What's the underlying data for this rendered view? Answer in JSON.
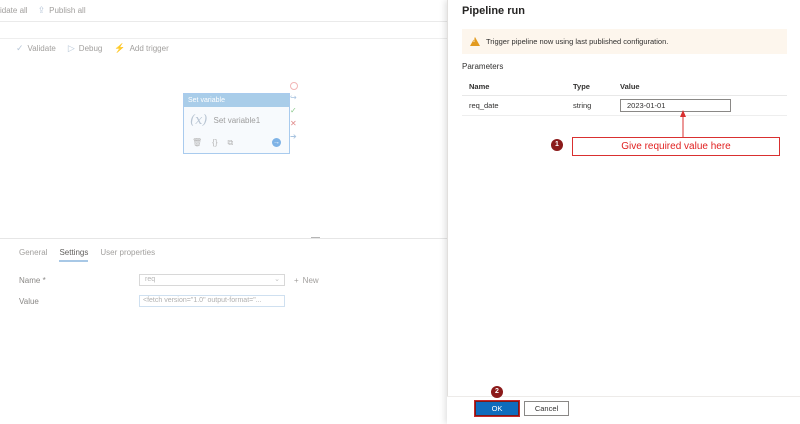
{
  "topbar": {
    "validate_all": "idate all",
    "publish_all": "Publish all"
  },
  "toolbar": {
    "validate": "Validate",
    "debug": "Debug",
    "add_trigger": "Add trigger"
  },
  "activity": {
    "header": "Set variable",
    "name": "Set variable1",
    "fx_symbol": "(𝑥)"
  },
  "bottom": {
    "tabs": [
      {
        "label": "General"
      },
      {
        "label": "Settings"
      },
      {
        "label": "User properties"
      }
    ],
    "name_label": "Name *",
    "name_value": "req",
    "new_label": "New",
    "value_label": "Value",
    "value_text": "<fetch version=\"1.0\" output-format=\"..."
  },
  "panel": {
    "title": "Pipeline run",
    "warning": "Trigger pipeline now using last published configuration.",
    "parameters_label": "Parameters",
    "columns": {
      "name": "Name",
      "type": "Type",
      "value": "Value"
    },
    "rows": [
      {
        "name": "req_date",
        "type": "string",
        "value": "2023-01-01"
      }
    ],
    "ok_label": "OK",
    "cancel_label": "Cancel"
  },
  "annotations": {
    "marker1": "1",
    "marker2": "2",
    "callout": "Give required value here",
    "colors": {
      "marker": "#8b1a1a",
      "callout_text": "#e02020",
      "callout_border": "#d93030",
      "arrow": "#d93030"
    }
  },
  "colors": {
    "primary_button": "#0f6cbd",
    "warning_bg": "#fdf6ed",
    "warning_icon": "#e29a1f"
  }
}
